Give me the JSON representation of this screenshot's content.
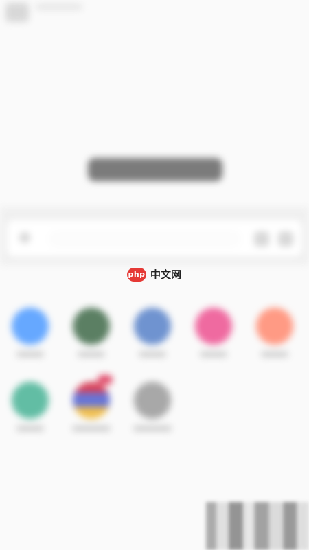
{
  "watermark": {
    "logo": "php",
    "text": "中文网"
  },
  "icons": {
    "search": "search-icon",
    "scan": "scan-icon",
    "more": "more-icon"
  },
  "colors": {
    "watermark_red": "#e53935",
    "app_blue": "#66a8ff",
    "app_green": "#5b7f63",
    "app_purple_blue": "#6f93d0",
    "app_pink": "#ef6aa0",
    "app_orange": "#ff9a84",
    "app_teal": "#62bda4",
    "app_gray": "#a8a8a8"
  }
}
